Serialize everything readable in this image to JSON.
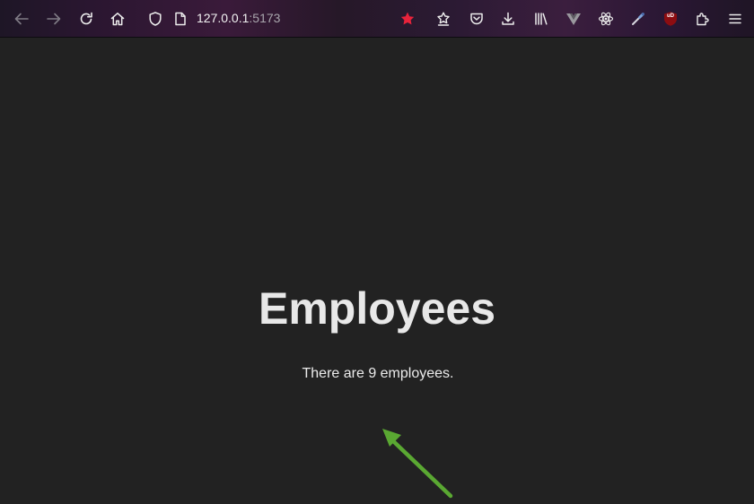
{
  "browser": {
    "url_host": "127.0.0.1",
    "url_port": ":5173",
    "icons": {
      "back": "arrow-left-icon",
      "forward": "arrow-right-icon",
      "reload": "reload-icon",
      "home": "home-icon",
      "shield": "shield-icon",
      "page": "page-icon",
      "bookmark": "star-icon",
      "pocket_save": "pocket-icon",
      "downloads": "download-icon",
      "library": "library-icon",
      "vue": "vue-devtools-icon",
      "react": "react-devtools-icon",
      "eyedropper": "eyedropper-icon",
      "ublock": "ublock-icon",
      "extensions": "puzzle-icon",
      "menu": "hamburger-icon"
    },
    "ublock_label": "uD",
    "star_color": "#e8233b"
  },
  "page": {
    "heading": "Employees",
    "count_text": "There are 9 employees.",
    "background": "#222222",
    "annotation_color": "#5aa832"
  }
}
